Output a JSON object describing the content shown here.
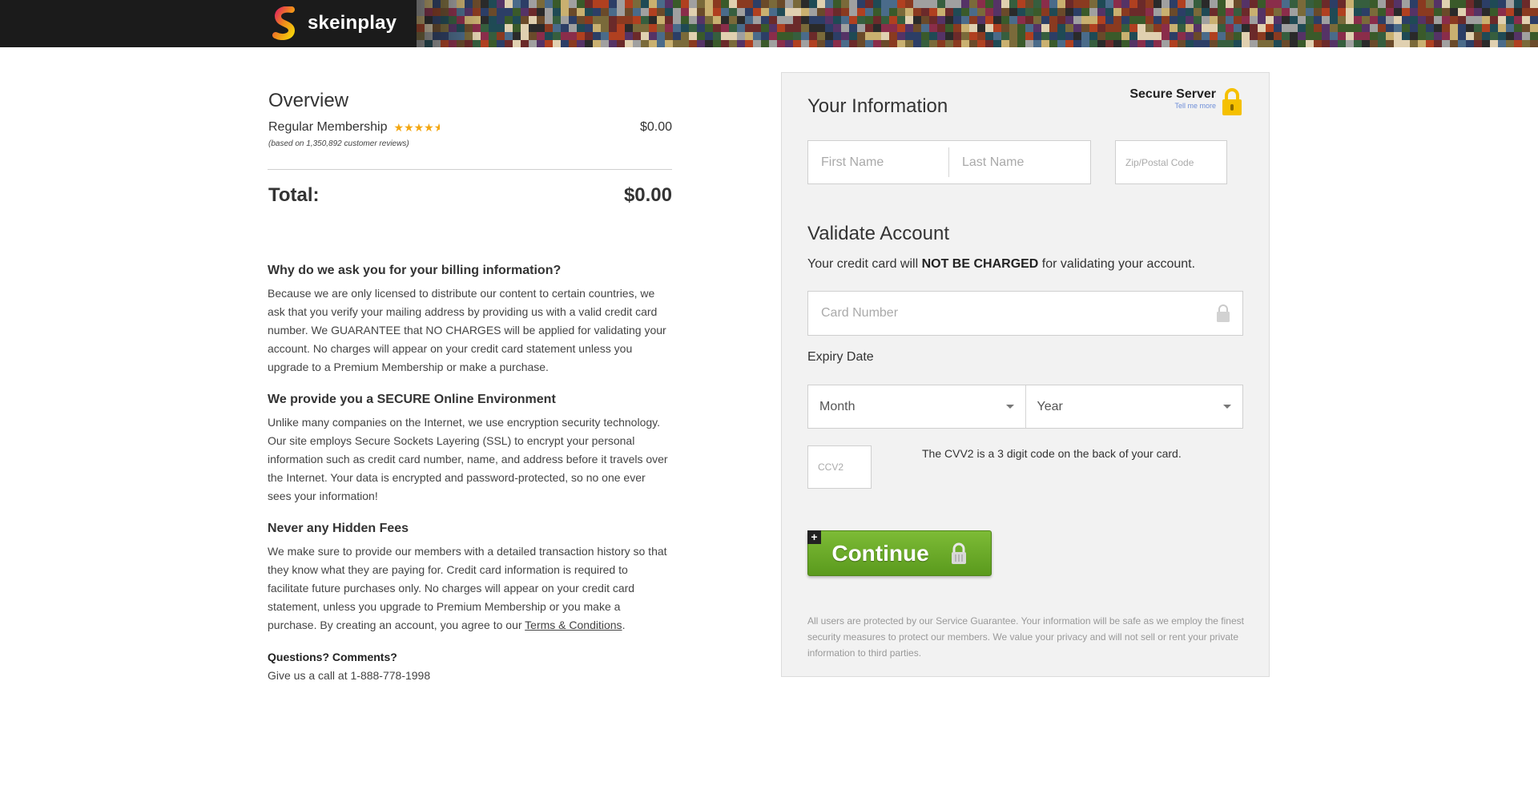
{
  "brand": {
    "name": "skeinplay"
  },
  "overview": {
    "title": "Overview",
    "membership_label": "Regular Membership",
    "rating_stars": 4.5,
    "membership_price": "$0.00",
    "reviews_note": "(based on 1,350,892 customer reviews)",
    "total_label": "Total:",
    "total_value": "$0.00"
  },
  "info": {
    "billing_heading": "Why do we ask you for your billing information?",
    "billing_text": "Because we are only licensed to distribute our content to certain countries, we ask that you verify your mailing address by providing us with a valid credit card number. We GUARANTEE that NO CHARGES will be applied for validating your account. No charges will appear on your credit card statement unless you upgrade to a Premium Membership or make a purchase.",
    "secure_heading": "We provide you a SECURE Online Environment",
    "secure_text": "Unlike many companies on the Internet, we use encryption security technology. Our site employs Secure Sockets Layering (SSL) to encrypt your personal information such as credit card number, name, and address before it travels over the Internet. Your data is encrypted and password-protected, so no one ever sees your information!",
    "fees_heading": "Never any Hidden Fees",
    "fees_text": "We make sure to provide our members with a detailed transaction history so that they know what they are paying for. Credit card information is required to facilitate future purchases only. No charges will appear on your credit card statement, unless you upgrade to Premium Membership or you make a purchase. By creating an account, you agree to our",
    "terms_link": "Terms & Conditions",
    "questions_heading": "Questions? Comments?",
    "questions_text": "Give us a call at 1-888-778-1998"
  },
  "form": {
    "your_info_title": "Your Information",
    "secure_server_label": "Secure Server",
    "tell_me_more": "Tell me more",
    "first_name_placeholder": "First Name",
    "last_name_placeholder": "Last Name",
    "zip_placeholder": "Zip/Postal Code",
    "validate_title": "Validate Account",
    "validate_prefix": "Your credit card will ",
    "validate_bold": "NOT BE CHARGED",
    "validate_suffix": " for validating your account.",
    "card_number_placeholder": "Card Number",
    "expiry_label": "Expiry Date",
    "month_selected": "Month",
    "year_selected": "Year",
    "ccv_placeholder": "CCV2",
    "cvv_note": "The CVV2 is a 3 digit code on the back of your card.",
    "continue_label": "Continue",
    "guarantee_text": "All users are protected by our Service Guarantee. Your information will be safe as we employ the finest security measures to protect our members. We value your privacy and will not sell or rent your private information to third parties."
  },
  "colors": {
    "header_bg": "#1b1b1b",
    "button_green": "#6aab28",
    "lock_yellow": "#f5c000",
    "star_orange": "#f3a712"
  }
}
